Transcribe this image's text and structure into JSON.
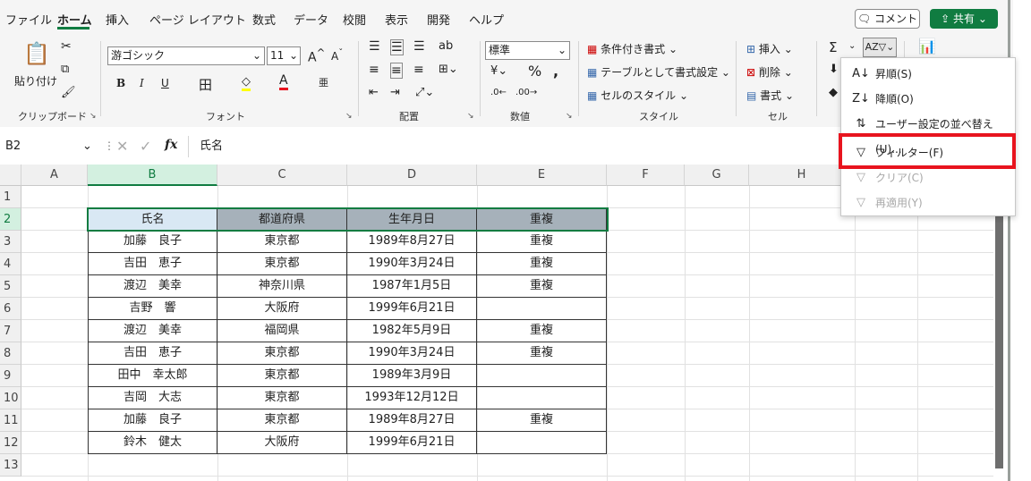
{
  "tabs": [
    "ファイル",
    "ホーム",
    "挿入",
    "ページ レイアウト",
    "数式",
    "データ",
    "校閲",
    "表示",
    "開発",
    "ヘルプ"
  ],
  "header": {
    "comment_label": "コメント",
    "share_label": "共有"
  },
  "ribbon": {
    "clipboard": {
      "paste_label": "貼り付け",
      "group_label": "クリップボード"
    },
    "font": {
      "name": "游ゴシック",
      "size": "11",
      "group_label": "フォント"
    },
    "alignment": {
      "group_label": "配置"
    },
    "number": {
      "format": "標準",
      "group_label": "数値"
    },
    "styles": {
      "conditional": "条件付き書式",
      "table": "テーブルとして書式設定",
      "cell_styles": "セルのスタイル",
      "group_label": "スタイル"
    },
    "cells": {
      "insert": "挿入",
      "delete": "削除",
      "format": "書式",
      "group_label": "セル"
    }
  },
  "formula_bar": {
    "name_box": "B2",
    "value": "氏名",
    "fx": "fx"
  },
  "grid": {
    "columns": [
      "A",
      "B",
      "C",
      "D",
      "E",
      "F",
      "G",
      "H"
    ],
    "rows": [
      "1",
      "2",
      "3",
      "4",
      "5",
      "6",
      "7",
      "8",
      "9",
      "10",
      "11",
      "12",
      "13"
    ],
    "table_headers": [
      "氏名",
      "都道府県",
      "生年月日",
      "重複"
    ],
    "table_rows": [
      [
        "加藤　良子",
        "東京都",
        "1989年8月27日",
        "重複"
      ],
      [
        "吉田　恵子",
        "東京都",
        "1990年3月24日",
        "重複"
      ],
      [
        "渡辺　美幸",
        "神奈川県",
        "1987年1月5日",
        "重複"
      ],
      [
        "吉野　響",
        "大阪府",
        "1999年6月21日",
        ""
      ],
      [
        "渡辺　美幸",
        "福岡県",
        "1982年5月9日",
        "重複"
      ],
      [
        "吉田　恵子",
        "東京都",
        "1990年3月24日",
        "重複"
      ],
      [
        "田中　幸太郎",
        "東京都",
        "1989年3月9日",
        ""
      ],
      [
        "吉岡　大志",
        "東京都",
        "1993年12月12日",
        ""
      ],
      [
        "加藤　良子",
        "東京都",
        "1989年8月27日",
        "重複"
      ],
      [
        "鈴木　健太",
        "大阪府",
        "1999年6月21日",
        ""
      ]
    ]
  },
  "sort_filter_menu": {
    "items": [
      {
        "label": "昇順(S)",
        "icon": "sort-ascending-icon",
        "enabled": true
      },
      {
        "label": "降順(O)",
        "icon": "sort-descending-icon",
        "enabled": true
      },
      {
        "label": "ユーザー設定の並べ替え(U)...",
        "icon": "custom-sort-icon",
        "enabled": true
      },
      {
        "label": "フィルター(F)",
        "icon": "filter-icon",
        "enabled": true
      },
      {
        "label": "クリア(C)",
        "icon": "clear-filter-icon",
        "enabled": false
      },
      {
        "label": "再適用(Y)",
        "icon": "reapply-icon",
        "enabled": false
      }
    ]
  },
  "colors": {
    "accent": "#107c41",
    "highlight": "#e8141e",
    "header_fill": "#a6b1ba"
  }
}
